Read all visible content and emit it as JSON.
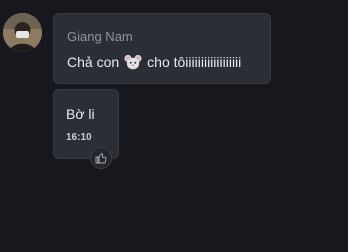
{
  "conversation": {
    "messages": [
      {
        "sender": "Giang Nam",
        "text_before_emoji": "Chả con",
        "emoji": "mouse-face-icon",
        "text_after_emoji": "cho tôiiiiiiiiiiiiiiiiii"
      },
      {
        "text": "Bờ li",
        "time": "16:10",
        "reaction_icon": "thumbs-up-icon"
      }
    ]
  }
}
